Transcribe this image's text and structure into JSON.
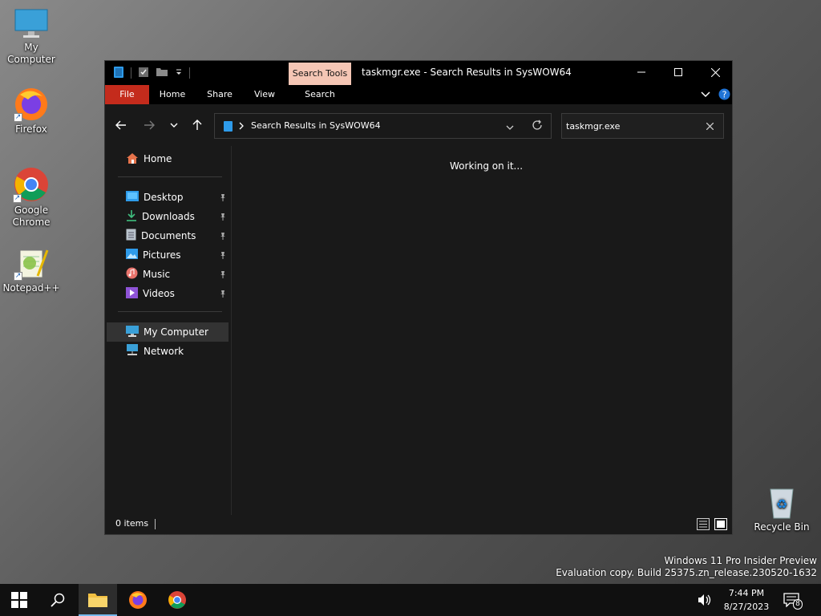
{
  "desktop": {
    "icons": [
      {
        "label": "My Computer",
        "icon": "computer-icon"
      },
      {
        "label": "Firefox",
        "icon": "firefox-icon"
      },
      {
        "label": "Google Chrome",
        "icon": "chrome-icon"
      },
      {
        "label": "Notepad++",
        "icon": "notepadpp-icon"
      },
      {
        "label": "Recycle Bin",
        "icon": "recycle-bin-icon"
      }
    ],
    "watermark": {
      "line1": "Windows 11 Pro Insider Preview",
      "line2": "Evaluation copy. Build 25375.zn_release.230520-1632"
    }
  },
  "window": {
    "title": "taskmgr.exe - Search Results in SysWOW64",
    "context_tab": "Search Tools",
    "ribbon_tabs": [
      "File",
      "Home",
      "Share",
      "View",
      "Search"
    ],
    "address": "Search Results in SysWOW64",
    "search_value": "taskmgr.exe",
    "status": "Working on it...",
    "item_count": "0 items",
    "sidebar": {
      "home": "Home",
      "quick_access": [
        {
          "label": "Desktop",
          "icon": "desktop-folder-icon",
          "pinned": true
        },
        {
          "label": "Downloads",
          "icon": "downloads-icon",
          "pinned": true
        },
        {
          "label": "Documents",
          "icon": "documents-icon",
          "pinned": true
        },
        {
          "label": "Pictures",
          "icon": "pictures-icon",
          "pinned": true
        },
        {
          "label": "Music",
          "icon": "music-icon",
          "pinned": true
        },
        {
          "label": "Videos",
          "icon": "videos-icon",
          "pinned": true
        }
      ],
      "my_computer": "My Computer",
      "network": "Network"
    }
  },
  "taskbar": {
    "time": "7:44 PM",
    "date": "8/27/2023",
    "notification_count": "8"
  },
  "colors": {
    "file_tab": "#c42b1c",
    "context_tab": "#f5c6b5",
    "window_bg": "#191919",
    "accent": "#76b9ed"
  }
}
